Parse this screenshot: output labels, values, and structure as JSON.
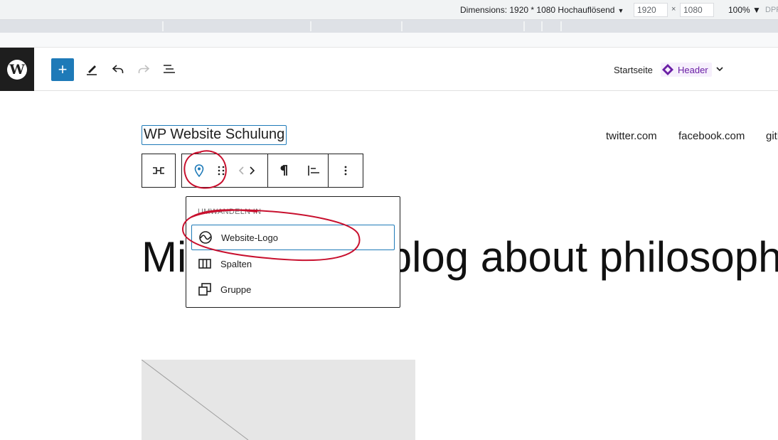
{
  "devtools": {
    "dimensions_label": "Dimensions: 1920 * 1080 Hochauflösend",
    "caret": "▼",
    "width_value": "1920",
    "height_value": "1080",
    "times": "×",
    "zoom_label": "100% ▼",
    "dpr_label": "DPR"
  },
  "toolbar": {
    "add_label": "+",
    "breadcrumb_page": "Startseite",
    "breadcrumb_template": "Header"
  },
  "canvas": {
    "site_title": "WP Website Schulung",
    "nav_links": [
      "twitter.com",
      "facebook.com",
      "gith"
    ],
    "headline": "Mi                 blog about philosophy"
  },
  "dropdown": {
    "header": "Umwandeln in",
    "items": [
      {
        "label": "Website-Logo",
        "icon": "site-logo-icon"
      },
      {
        "label": "Spalten",
        "icon": "columns-icon"
      },
      {
        "label": "Gruppe",
        "icon": "group-icon"
      }
    ]
  },
  "colors": {
    "wp_blue": "#1e7ab8",
    "annotation_red": "#c8102e",
    "template_purple": "#6a1ea5"
  }
}
